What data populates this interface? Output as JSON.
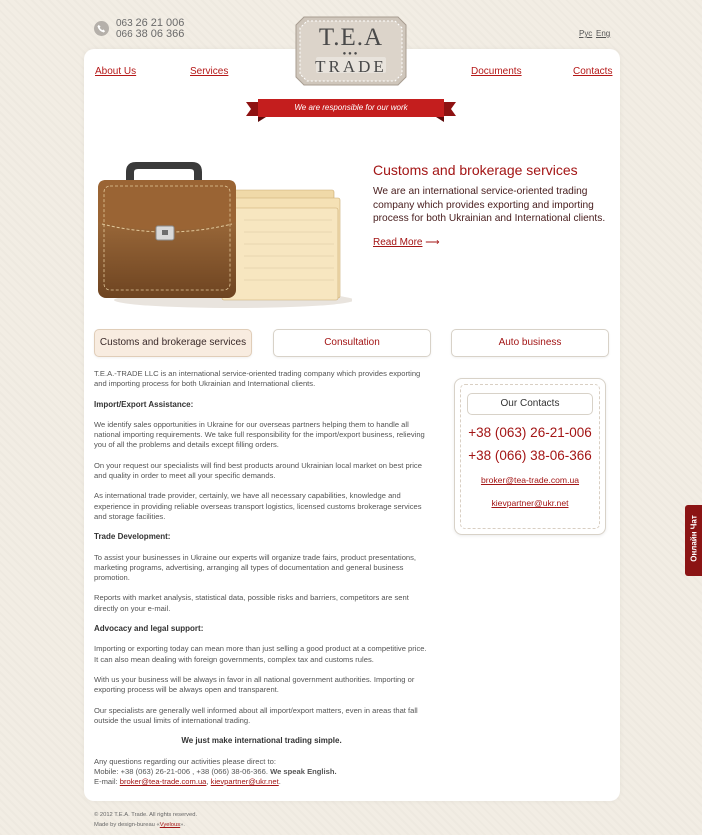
{
  "header": {
    "phone1_prefix": "063",
    "phone1_number": "26 21 006",
    "phone2_prefix": "066",
    "phone2_number": "38 06 366",
    "lang_ru": "Рус",
    "lang_en": "Eng",
    "logo_line1": "T.E.A",
    "logo_line2": "TRADE"
  },
  "nav": {
    "about": "About Us",
    "services": "Services",
    "documents": "Documents",
    "contacts": "Contacts"
  },
  "ribbon": "We are responsible for our work",
  "hero": {
    "title": "Customs and brokerage services",
    "text": "We are an international service-oriented trading company which provides exporting and importing process for both Ukrainian and International clients.",
    "read_more": "Read More",
    "arrow": "⟶"
  },
  "tabs": [
    {
      "label": "Customs and brokerage services"
    },
    {
      "label": "Consultation"
    },
    {
      "label": "Auto business"
    }
  ],
  "body": {
    "intro": "T.E.A.-TRADE LLC is an international service-oriented trading company which provides exporting and importing process for both Ukrainian and International clients.",
    "h1": "Import/Export Assistance:",
    "p1": "We identify sales opportunities in Ukraine for our overseas partners helping them to handle all national importing requirements. We take full responsibility for the import/export business, relieving you of all the problems and details except filling orders.",
    "p2": "On your request our specialists will find best products around Ukrainian local market on best price and quality in order to meet all your specific demands.",
    "p3": "As international trade provider, certainly, we have all necessary capabilities, knowledge and experience in providing reliable overseas transport logistics, licensed customs brokerage services and storage facilities.",
    "h2": "Trade Development:",
    "p4": "To assist your businesses in Ukraine our experts will organize trade fairs, product presentations, marketing programs, advertising, arranging all types of documentation and general business promotion.",
    "p5": "Reports with market analysis, statistical data, possible risks and barriers, competitors are sent directly on your e-mail.",
    "h3": "Advocacy and legal support:",
    "p6": "Importing or exporting today can mean more than just selling a good product at a competitive price. It can also mean dealing with foreign governments, complex tax and customs rules.",
    "p7": "With us your business will be always in favor in all national government authorities. Importing or exporting process will be always open and transparent.",
    "p8": "Our specialists are generally well informed about all import/export matters, even in areas that fall outside the usual limits of international trading.",
    "slogan": "We just make international trading simple.",
    "q_line": "Any questions regarding our activities please direct to:",
    "mobile_label": "Mobile: +38 (063) 26-21-006 , +38 (066) 38-06-366.",
    "speak": "We speak English.",
    "email_label": "E-mail:",
    "email1": "broker@tea-trade.com.ua",
    "email2": "kievpartner@ukr.net",
    "comma": ",",
    "period": "."
  },
  "contacts": {
    "title": "Our Contacts",
    "phone1": "+38 (063) 26-21-006",
    "phone2": "+38 (066) 38-06-366",
    "email1": "broker@tea-trade.com.ua",
    "email2": "kievpartner@ukr.net"
  },
  "footer": {
    "copyright": "© 2012 T.E.A. Trade. All rights reserved.",
    "made_by": "Made by design-bureau «",
    "studio": "Vyelous",
    "made_end": "»."
  },
  "chat": "Онлайн Чат",
  "colors": {
    "accent": "#a31515",
    "ribbon": "#c41e1e",
    "chat": "#8b1414"
  }
}
